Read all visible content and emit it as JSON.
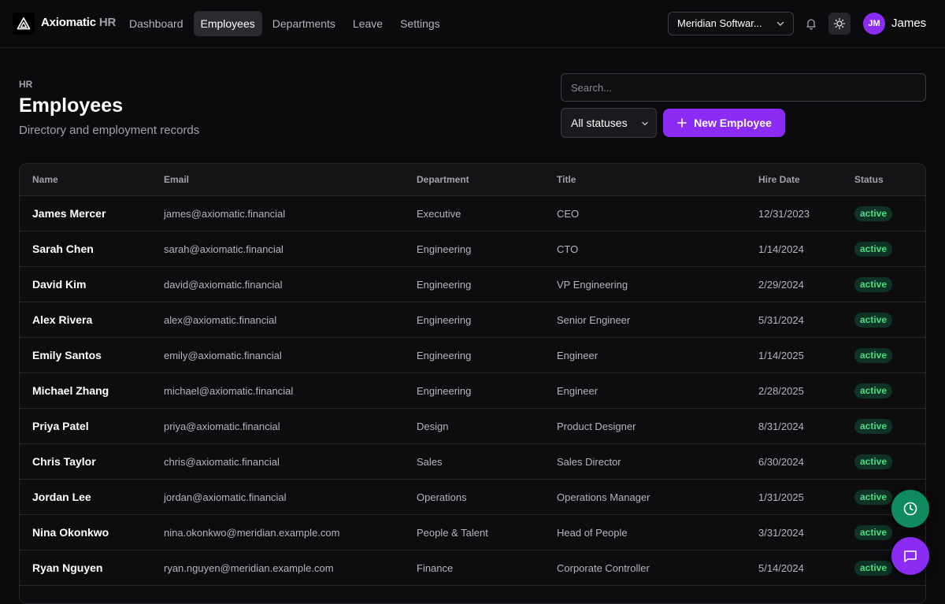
{
  "brand": {
    "name": "Axiomatic",
    "suffix": "HR"
  },
  "nav": [
    {
      "label": "Dashboard",
      "active": false
    },
    {
      "label": "Employees",
      "active": true
    },
    {
      "label": "Departments",
      "active": false
    },
    {
      "label": "Leave",
      "active": false
    },
    {
      "label": "Settings",
      "active": false
    }
  ],
  "org_select": {
    "value": "Meridian Softwar..."
  },
  "user": {
    "initials": "JM",
    "name": "James"
  },
  "header": {
    "breadcrumb": "HR",
    "title": "Employees",
    "subtitle": "Directory and employment records"
  },
  "search": {
    "placeholder": "Search..."
  },
  "status_filter": {
    "value": "All statuses"
  },
  "new_button": {
    "label": "New Employee"
  },
  "table": {
    "columns": [
      "Name",
      "Email",
      "Department",
      "Title",
      "Hire Date",
      "Status"
    ],
    "rows": [
      {
        "name": "James Mercer",
        "email": "james@axiomatic.financial",
        "department": "Executive",
        "title": "CEO",
        "hire_date": "12/31/2023",
        "status": "active"
      },
      {
        "name": "Sarah Chen",
        "email": "sarah@axiomatic.financial",
        "department": "Engineering",
        "title": "CTO",
        "hire_date": "1/14/2024",
        "status": "active"
      },
      {
        "name": "David Kim",
        "email": "david@axiomatic.financial",
        "department": "Engineering",
        "title": "VP Engineering",
        "hire_date": "2/29/2024",
        "status": "active"
      },
      {
        "name": "Alex Rivera",
        "email": "alex@axiomatic.financial",
        "department": "Engineering",
        "title": "Senior Engineer",
        "hire_date": "5/31/2024",
        "status": "active"
      },
      {
        "name": "Emily Santos",
        "email": "emily@axiomatic.financial",
        "department": "Engineering",
        "title": "Engineer",
        "hire_date": "1/14/2025",
        "status": "active"
      },
      {
        "name": "Michael Zhang",
        "email": "michael@axiomatic.financial",
        "department": "Engineering",
        "title": "Engineer",
        "hire_date": "2/28/2025",
        "status": "active"
      },
      {
        "name": "Priya Patel",
        "email": "priya@axiomatic.financial",
        "department": "Design",
        "title": "Product Designer",
        "hire_date": "8/31/2024",
        "status": "active"
      },
      {
        "name": "Chris Taylor",
        "email": "chris@axiomatic.financial",
        "department": "Sales",
        "title": "Sales Director",
        "hire_date": "6/30/2024",
        "status": "active"
      },
      {
        "name": "Jordan Lee",
        "email": "jordan@axiomatic.financial",
        "department": "Operations",
        "title": "Operations Manager",
        "hire_date": "1/31/2025",
        "status": "active"
      },
      {
        "name": "Nina Okonkwo",
        "email": "nina.okonkwo@meridian.example.com",
        "department": "People & Talent",
        "title": "Head of People",
        "hire_date": "3/31/2024",
        "status": "active"
      },
      {
        "name": "Ryan Nguyen",
        "email": "ryan.nguyen@meridian.example.com",
        "department": "Finance",
        "title": "Corporate Controller",
        "hire_date": "5/14/2024",
        "status": "active"
      }
    ]
  },
  "colors": {
    "accent": "#8b2cf5",
    "status_active_bg": "#0f3326",
    "status_active_fg": "#4ade80",
    "fab_clock": "#0f8b5f"
  },
  "icons": {
    "logo": "triangle-logo-icon",
    "bell": "bell-icon",
    "theme": "sun-icon",
    "clock": "clock-icon",
    "chat": "chat-icon"
  }
}
